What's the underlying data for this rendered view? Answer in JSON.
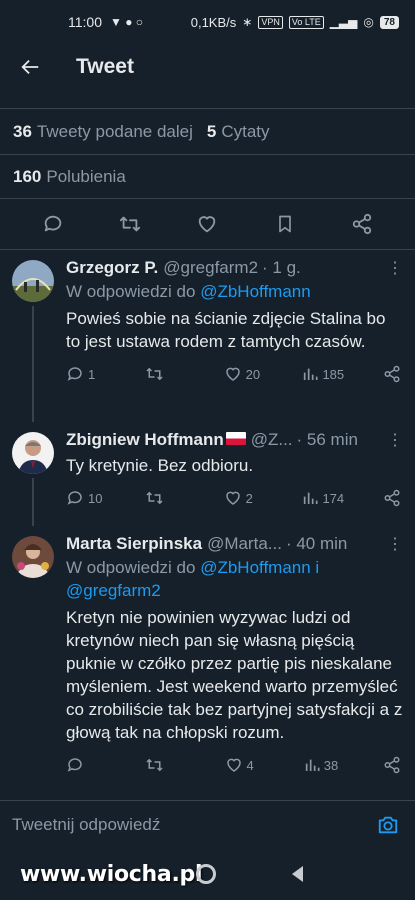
{
  "status_bar": {
    "time": "11:00",
    "speed": "0,1KB/s",
    "vpn_label": "VPN",
    "volte_label": "Vo LTE",
    "battery": "78"
  },
  "header": {
    "title": "Tweet"
  },
  "stats": {
    "retweets_count": "36",
    "retweets_label": "Tweety podane dalej",
    "quotes_count": "5",
    "quotes_label": "Cytaty",
    "likes_count": "160",
    "likes_label": "Polubienia"
  },
  "replies": [
    {
      "name": "Grzegorz P.",
      "handle": "@gregfarm2",
      "time": "· 1 g.",
      "replying_prefix": "W odpowiedzi do",
      "replying_to": "@ZbHoffmann",
      "text": "Powieś sobie na ścianie zdjęcie Stalina bo to jest ustawa rodem z tamtych czasów.",
      "replies": "1",
      "retweets": "",
      "likes": "20",
      "views": "185"
    },
    {
      "name": "Zbigniew Hoffmann",
      "handle": "@Z...",
      "time": "· 56 min",
      "text": "Ty kretynie. Bez odbioru.",
      "replies": "10",
      "retweets": "",
      "likes": "2",
      "views": "174"
    },
    {
      "name": "Marta Sierpinska",
      "handle": "@Marta...",
      "time": "· 40 min",
      "replying_prefix": "W odpowiedzi do",
      "replying_to": "@ZbHoffmann i @gregfarm2",
      "text": "Kretyn nie powinien wyzywac ludzi od kretynów niech pan się własną pięścią puknie w czółko przez partię pis nieskalane myśleniem. Jest weekend warto przemyśleć co zrobiliście tak bez partyjnej satysfakcji a z głową tak na chłopski rozum.",
      "replies": "",
      "retweets": "",
      "likes": "4",
      "views": "38"
    }
  ],
  "compose": {
    "placeholder": "Tweetnij odpowiedź"
  },
  "watermark": "www.wiocha.pl",
  "colors": {
    "background": "#15202b",
    "accent": "#1d9bf0",
    "muted": "#8b98a5",
    "divider": "#38444d"
  }
}
